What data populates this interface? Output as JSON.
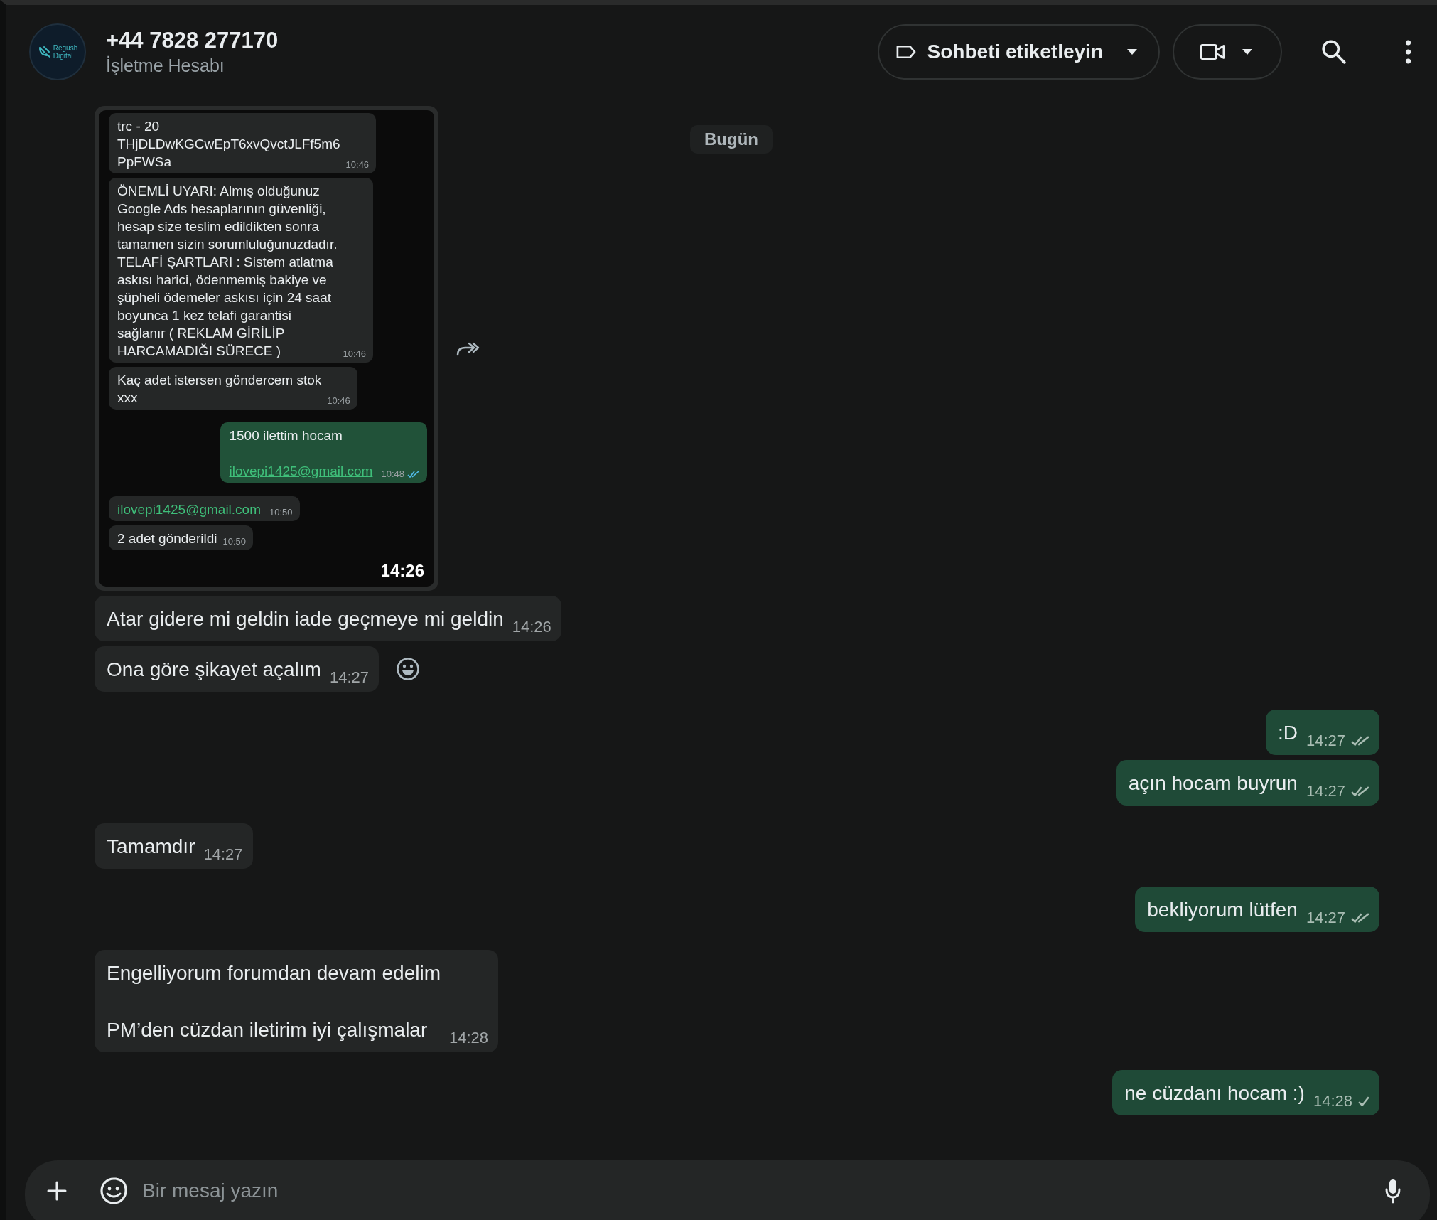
{
  "header": {
    "avatar_logo": [
      "Regush",
      "Digital"
    ],
    "title": "+44 7828 277170",
    "subtitle": "İşletme Hesabı",
    "label_button": "Sohbeti etiketleyin"
  },
  "date_pill": "Bugün",
  "messages": [
    {
      "kind": "image",
      "outgoing": false,
      "time": "14:26",
      "forward_button": true,
      "emoji_button": false,
      "screenshot": [
        {
          "outgoing": false,
          "text": "trc - 20\nTHjDLDwKGCwEpT6xvQvctJLFf5m6\nPpFWSa",
          "time": "10:46"
        },
        {
          "outgoing": false,
          "text": "ÖNEMLİ UYARI: Almış olduğunuz\nGoogle Ads hesaplarının güvenliği,\nhesap size teslim edildikten sonra\ntamamen sizin sorumluluğunuzdadır.\nTELAFİ ŞARTLARI : Sistem atlatma\naskısı harici, ödenmemiş bakiye ve\nşüpheli ödemeler askısı için 24 saat\nboyunca 1 kez telafi garantisi\nsağlanır ( REKLAM GİRİLİP\nHARCAMADIĞI SÜRECE )",
          "time": "10:46"
        },
        {
          "outgoing": false,
          "text": "Kaç adet istersen göndercem stok\nxxx",
          "time": "10:46"
        },
        {
          "outgoing": true,
          "text": "1500 ilettim hocam",
          "link": "ilovepi1425@gmail.com",
          "time": "10:48",
          "delivered": true,
          "read": true
        },
        {
          "outgoing": false,
          "link": "ilovepi1425@gmail.com",
          "time": "10:50"
        },
        {
          "outgoing": false,
          "text": "2 adet gönderildi",
          "time": "10:50"
        }
      ]
    },
    {
      "kind": "text",
      "outgoing": false,
      "text": "Atar gidere mi geldin iade geçmeye mi geldin",
      "time": "14:26",
      "forward_button": false,
      "emoji_button": false
    },
    {
      "kind": "text",
      "outgoing": false,
      "text": "Ona göre şikayet açalım",
      "time": "14:27",
      "forward_button": false,
      "emoji_button": true
    },
    {
      "kind": "text",
      "outgoing": true,
      "text": ":D",
      "time": "14:27",
      "delivered": true,
      "read": false,
      "forward_button": false,
      "emoji_button": false
    },
    {
      "kind": "text",
      "outgoing": true,
      "text": "açın hocam buyrun",
      "time": "14:27",
      "delivered": true,
      "read": false,
      "forward_button": false,
      "emoji_button": false
    },
    {
      "kind": "text",
      "outgoing": false,
      "text": "Tamamdır",
      "time": "14:27",
      "forward_button": false,
      "emoji_button": false
    },
    {
      "kind": "text",
      "outgoing": true,
      "text": "bekliyorum lütfen",
      "time": "14:27",
      "delivered": true,
      "read": false,
      "forward_button": false,
      "emoji_button": false
    },
    {
      "kind": "text",
      "outgoing": false,
      "text": "Engelliyorum forumdan devam edelim\n\nPM’den cüzdan iletirim iyi çalışmalar",
      "time": "14:28",
      "forward_button": false,
      "emoji_button": false
    },
    {
      "kind": "text",
      "outgoing": true,
      "text": "ne cüzdanı hocam :)",
      "time": "14:28",
      "delivered": false,
      "read": false,
      "forward_button": false,
      "emoji_button": false
    }
  ],
  "composer": {
    "placeholder": "Bir mesaj yazın"
  }
}
